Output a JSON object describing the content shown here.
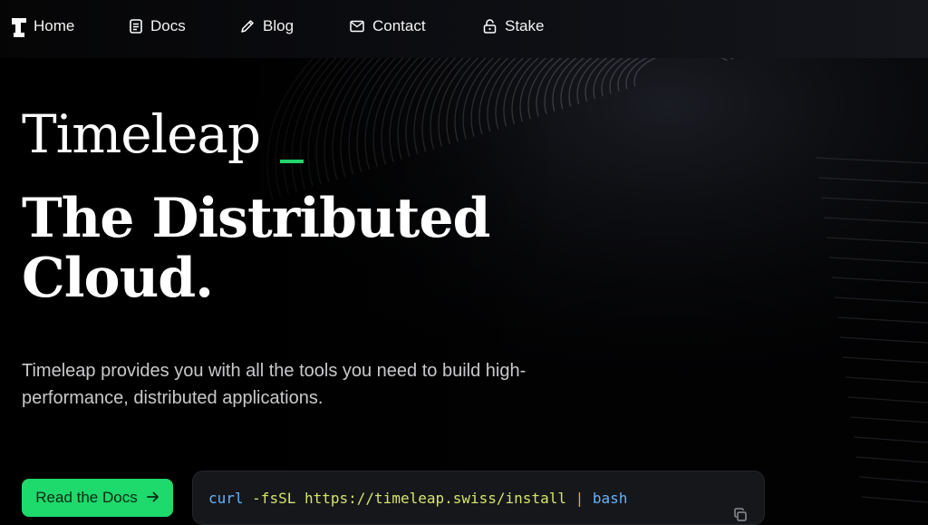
{
  "nav": {
    "items": [
      {
        "label": "Home",
        "icon": "timeleap-logo-icon"
      },
      {
        "label": "Docs",
        "icon": "document-icon"
      },
      {
        "label": "Blog",
        "icon": "pencil-icon"
      },
      {
        "label": "Contact",
        "icon": "mail-icon"
      },
      {
        "label": "Stake",
        "icon": "lock-icon"
      }
    ]
  },
  "hero": {
    "brand": "Timeleap",
    "headline": "The Distributed Cloud.",
    "description": "Timeleap provides you with all the tools you need to build high-performance, distributed applications.",
    "cta_label": "Read the Docs",
    "command": {
      "cmd": "curl",
      "flag": "-fsSL",
      "url": "https://timeleap.swiss/install",
      "pipe": "|",
      "shell": "bash"
    }
  },
  "colors": {
    "accent": "#1ed96c",
    "cmd_keyword": "#62b3ff",
    "cmd_string": "#d6e56a",
    "cmd_pipe": "#e0a060"
  }
}
